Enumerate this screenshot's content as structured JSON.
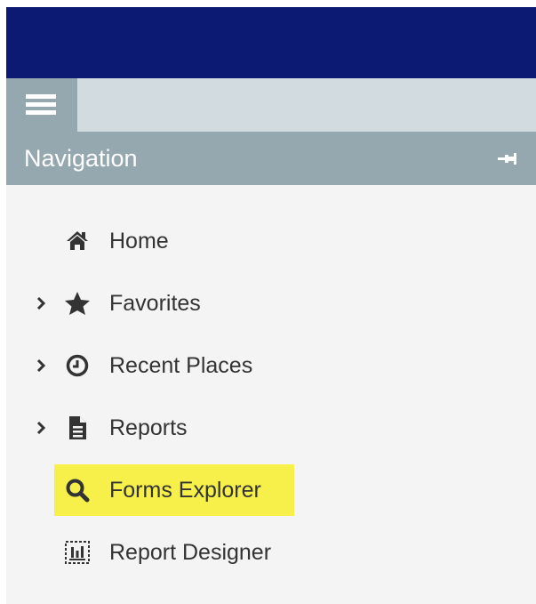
{
  "colors": {
    "banner": "#0c1a73",
    "toolbar": "#d2dbdf",
    "nav_header": "#95a7af",
    "panel_background": "#f4f4f4",
    "highlight": "#f7f04a",
    "text": "#333333"
  },
  "navigation": {
    "title": "Navigation",
    "pin_icon": "pin-icon",
    "items": [
      {
        "label": "Home",
        "icon": "home-icon",
        "expandable": false
      },
      {
        "label": "Favorites",
        "icon": "star-icon",
        "expandable": true
      },
      {
        "label": "Recent Places",
        "icon": "clock-icon",
        "expandable": true
      },
      {
        "label": "Reports",
        "icon": "document-icon",
        "expandable": true
      },
      {
        "label": "Forms Explorer",
        "icon": "search-icon",
        "expandable": false,
        "highlighted": true
      },
      {
        "label": "Report Designer",
        "icon": "report-designer-icon",
        "expandable": false
      }
    ]
  }
}
